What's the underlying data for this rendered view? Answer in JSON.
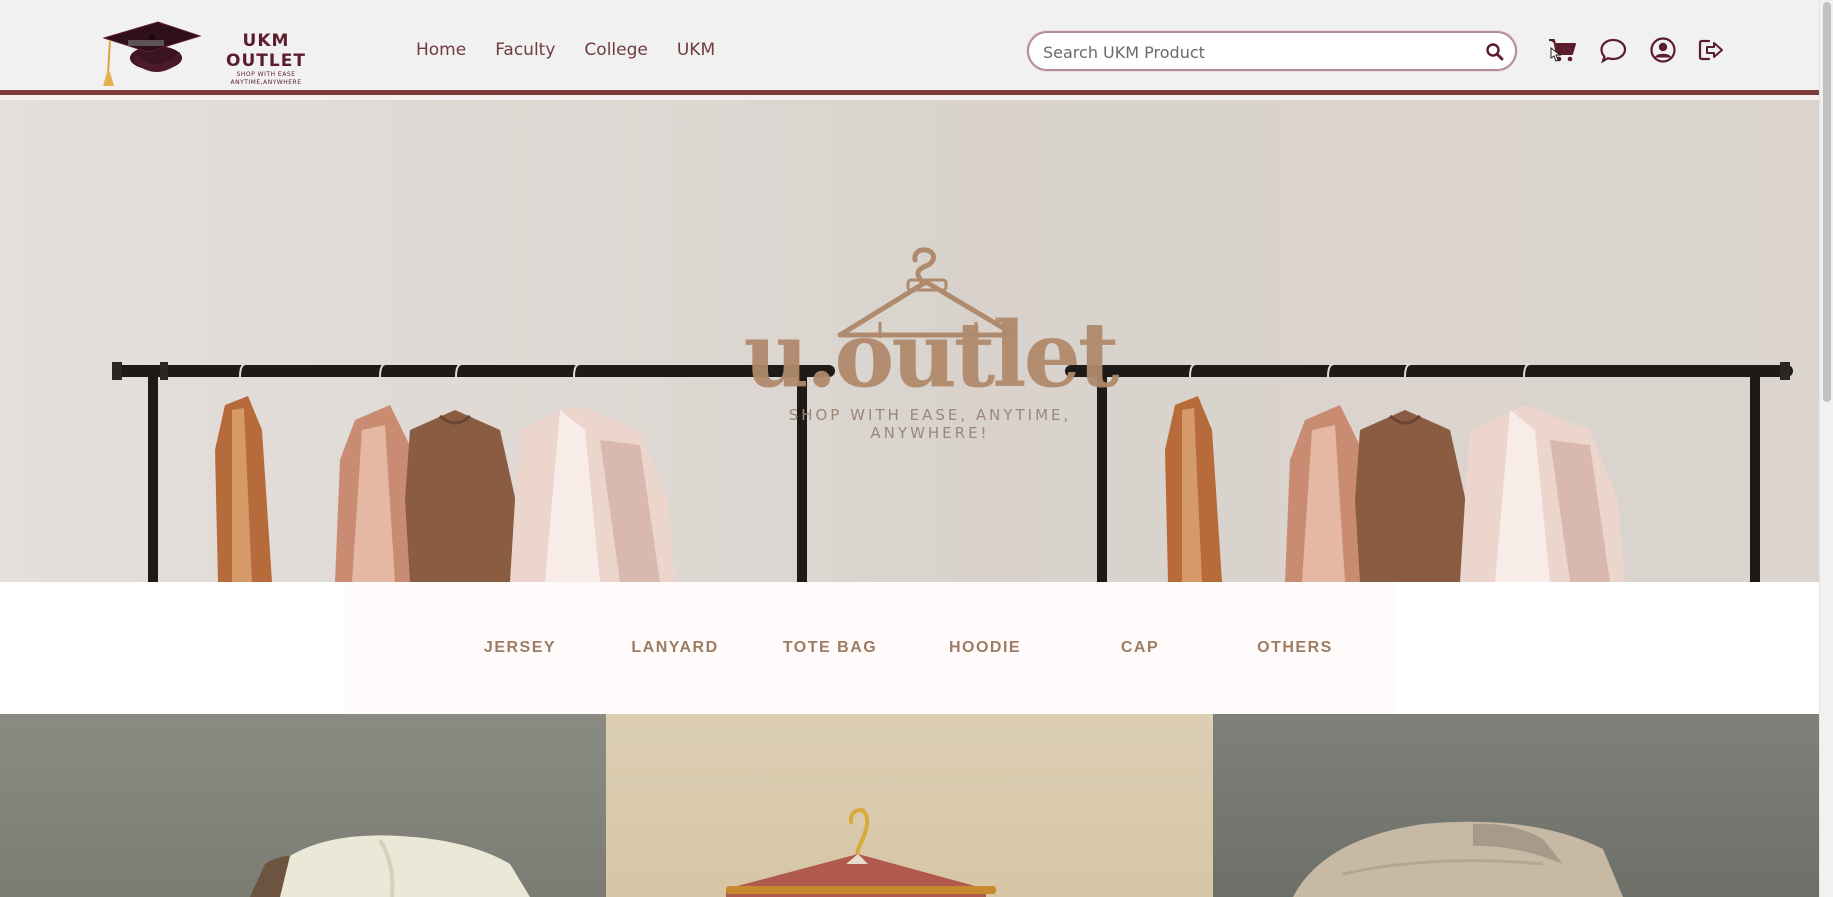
{
  "brand": {
    "name": "UKM OUTLET",
    "tagline_line1": "SHOP WITH EASE",
    "tagline_line2": "ANYTIME,ANYWHERE"
  },
  "nav": {
    "links": [
      "Home",
      "Faculty",
      "College",
      "UKM"
    ]
  },
  "search": {
    "placeholder": "Search UKM Product",
    "icon": "search-icon"
  },
  "header_icons": [
    "cart-icon",
    "chat-icon",
    "account-icon",
    "logout-icon"
  ],
  "hero": {
    "wordmark": "u.outlet",
    "tagline": "SHOP WITH EASE, ANYTIME, ANYWHERE!"
  },
  "categories": [
    "JERSEY",
    "LANYARD",
    "TOTE BAG",
    "HOODIE",
    "CAP",
    "OTHERS"
  ],
  "colors": {
    "brand_maroon": "#5b1d2c",
    "nav_border": "#7d3a3a",
    "nav_text": "#6f3b3f",
    "category_text": "#9e7c63",
    "hero_accent": "#b08a6c"
  }
}
